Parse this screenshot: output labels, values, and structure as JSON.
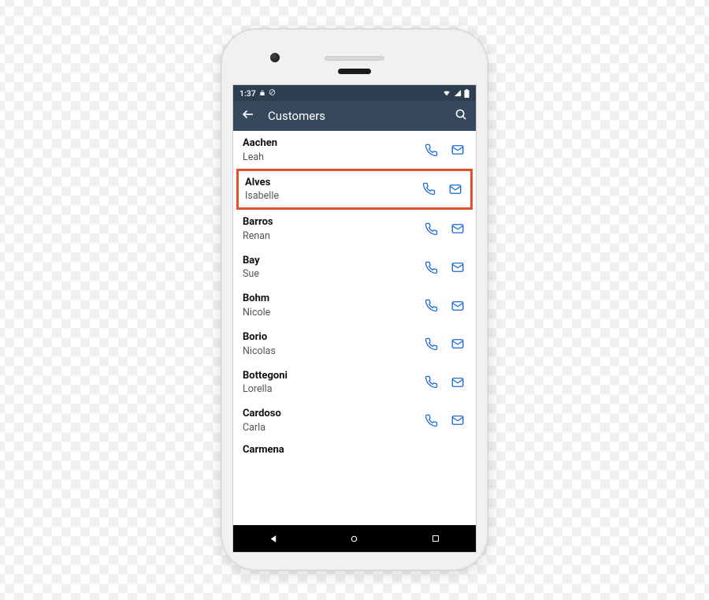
{
  "status": {
    "time": "1:37"
  },
  "appbar": {
    "title": "Customers"
  },
  "colors": {
    "header": "#36485b",
    "status": "#2d3e50",
    "accent": "#1a68d6",
    "highlight": "#e2512c"
  },
  "customers": [
    {
      "last": "Aachen",
      "first": "Leah",
      "highlight": false
    },
    {
      "last": "Alves",
      "first": "Isabelle",
      "highlight": true
    },
    {
      "last": "Barros",
      "first": "Renan",
      "highlight": false
    },
    {
      "last": "Bay",
      "first": "Sue",
      "highlight": false
    },
    {
      "last": "Bohm",
      "first": "Nicole",
      "highlight": false
    },
    {
      "last": "Borio",
      "first": "Nicolas",
      "highlight": false
    },
    {
      "last": "Bottegoni",
      "first": "Lorella",
      "highlight": false
    },
    {
      "last": "Cardoso",
      "first": "Carla",
      "highlight": false
    },
    {
      "last": "Carmena",
      "first": "",
      "highlight": false
    }
  ]
}
